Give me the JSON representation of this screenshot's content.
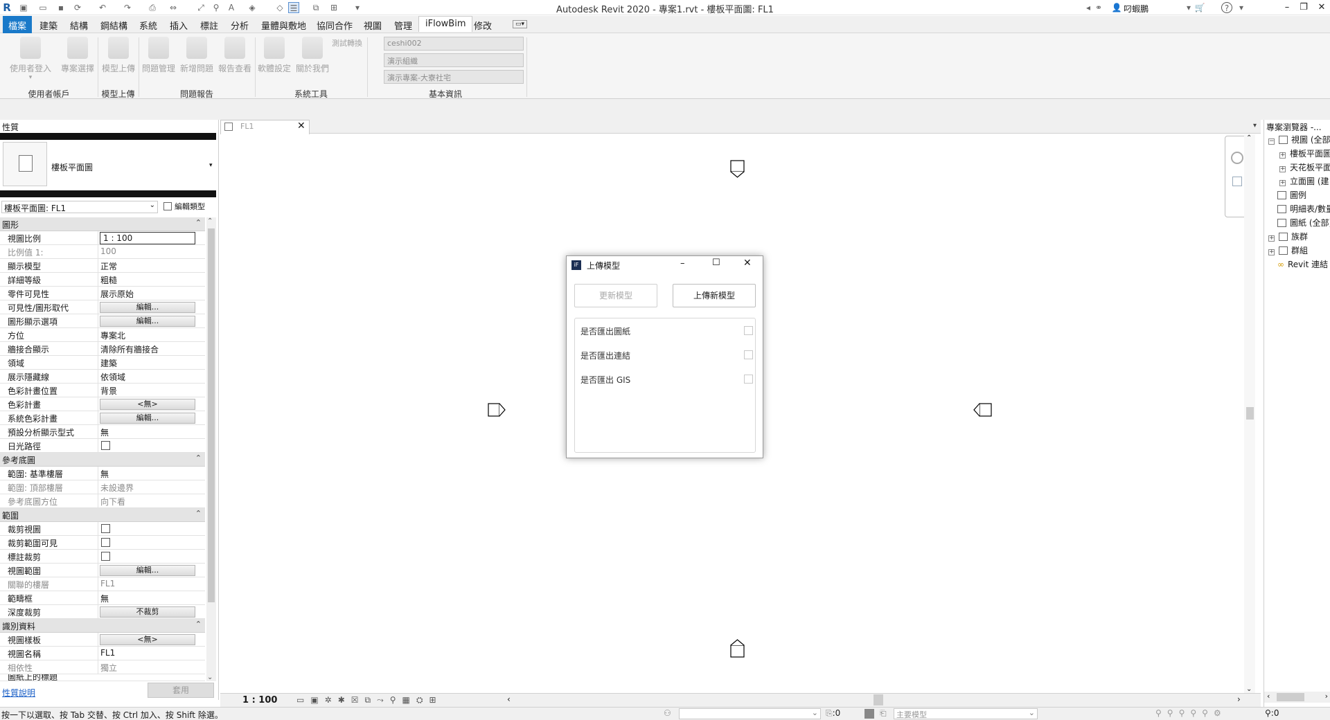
{
  "app": {
    "title": "Autodesk Revit 2020 - 專案1.rvt - 樓板平面圖: FL1",
    "user": "叼蝦鵬"
  },
  "menu": [
    "檔案",
    "建築",
    "結構",
    "鋼結構",
    "系統",
    "插入",
    "標註",
    "分析",
    "量體與敷地",
    "協同合作",
    "視圖",
    "管理",
    "iFlowBim",
    "修改"
  ],
  "ribbon": {
    "buttons": [
      "使用者登入",
      "專案選擇",
      "模型上傳",
      "問題管理",
      "新增問題",
      "報告查看",
      "軟體設定",
      "關於我們"
    ],
    "test_label": "測試轉換",
    "groups": [
      "使用者帳戶",
      "模型上傳",
      "問題報告",
      "系統工具",
      "基本資訊"
    ],
    "info_fields": [
      "ceshi002",
      "演示組織",
      "演示專案-大寮社宅"
    ]
  },
  "properties": {
    "title": "性質",
    "type_name": "樓板平面圖",
    "instance_selector": "樓板平面圖: FL1",
    "edit_type": "編輯類型",
    "apply": "套用",
    "help": "性質說明",
    "sections": {
      "graphics": "圖形",
      "underlay": "參考底圖",
      "extents": "範圍",
      "identity": "識別資料"
    },
    "rows": {
      "r1": {
        "label": "視圖比例",
        "value": "1 : 100"
      },
      "r2": {
        "label": "比例值 1:",
        "value": "100"
      },
      "r3": {
        "label": "顯示模型",
        "value": "正常"
      },
      "r4": {
        "label": "詳細等級",
        "value": "粗糙"
      },
      "r5": {
        "label": "零件可見性",
        "value": "展示原始"
      },
      "r6": {
        "label": "可見性/圖形取代",
        "value": "編輯..."
      },
      "r7": {
        "label": "圖形顯示選項",
        "value": "編輯..."
      },
      "r8": {
        "label": "方位",
        "value": "專案北"
      },
      "r9": {
        "label": "牆接合顯示",
        "value": "清除所有牆接合"
      },
      "r10": {
        "label": "領域",
        "value": "建築"
      },
      "r11": {
        "label": "展示隱藏線",
        "value": "依領域"
      },
      "r12": {
        "label": "色彩計畫位置",
        "value": "背景"
      },
      "r13": {
        "label": "色彩計畫",
        "value": "<無>"
      },
      "r14": {
        "label": "系統色彩計畫",
        "value": "編輯..."
      },
      "r15": {
        "label": "預設分析顯示型式",
        "value": "無"
      },
      "r16": {
        "label": "日光路徑",
        "value": ""
      },
      "u1": {
        "label": "範圍: 基準樓層",
        "value": "無"
      },
      "u2": {
        "label": "範圍: 頂部樓層",
        "value": "未設邊界"
      },
      "u3": {
        "label": "參考底圖方位",
        "value": "向下看"
      },
      "e1": {
        "label": "裁剪視圖",
        "value": ""
      },
      "e2": {
        "label": "裁剪範圍可見",
        "value": ""
      },
      "e3": {
        "label": "標註裁剪",
        "value": ""
      },
      "e4": {
        "label": "視圖範圍",
        "value": "編輯..."
      },
      "e5": {
        "label": "關聯的樓層",
        "value": "FL1"
      },
      "e6": {
        "label": "範疇框",
        "value": "無"
      },
      "e7": {
        "label": "深度裁剪",
        "value": "不裁剪"
      },
      "i1": {
        "label": "視圖樣板",
        "value": "<無>"
      },
      "i2": {
        "label": "視圖名稱",
        "value": "FL1"
      },
      "i3": {
        "label": "相依性",
        "value": "獨立"
      },
      "i4": {
        "label": "圖紙上的標題",
        "value": ""
      }
    }
  },
  "view_tab": "FL1",
  "view_scale": "1 : 100",
  "status": {
    "hint": "按一下以選取、按 Tab 交替、按 Ctrl 加入、按 Shift 除選。",
    "count": ":0",
    "model": "主要模型",
    "filter": ":0"
  },
  "browser": {
    "title": "專案瀏覽器 -...",
    "items": [
      "視圖 (全部)",
      "樓板平面圖",
      "天花板平面圖",
      "立面圖 (建",
      "圖例",
      "明細表/數量",
      "圖紙 (全部)",
      "族群",
      "群組",
      "Revit 連結"
    ]
  },
  "dialog": {
    "title": "上傳模型",
    "update_button": "更新模型",
    "upload_button": "上傳新模型",
    "options": [
      {
        "label": "是否匯出圖紙",
        "checked": false
      },
      {
        "label": "是否匯出連結",
        "checked": false
      },
      {
        "label": "是否匯出 GIS",
        "checked": false
      }
    ]
  },
  "colors": {
    "accent": "#1979c9",
    "ribbon_bg": "#f5f5f5",
    "panel_bar": "#111111"
  }
}
